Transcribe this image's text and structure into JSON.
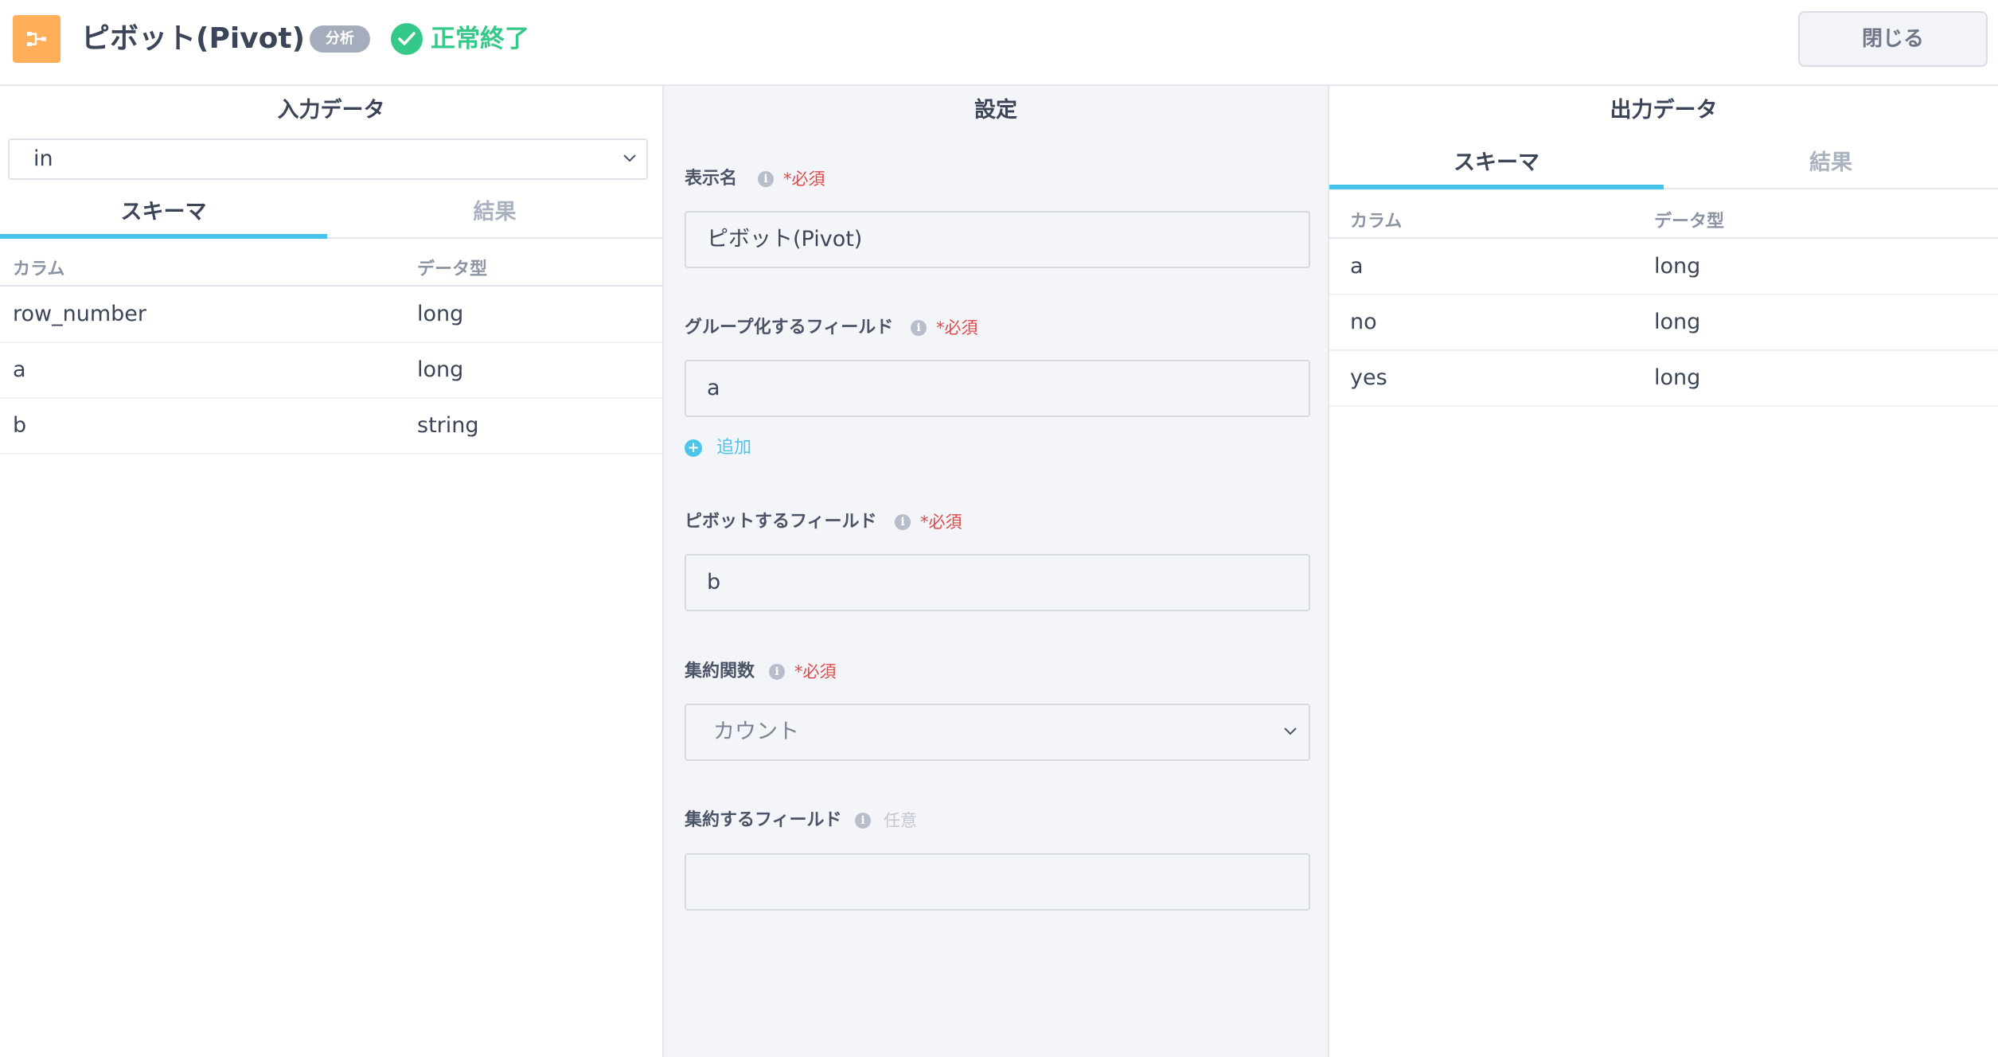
{
  "header": {
    "title": "ピボット(Pivot)",
    "category_badge": "分析",
    "status_text": "正常終了",
    "close_label": "閉じる",
    "node_icon": "pivot-node-icon",
    "accent_color": "#ffae5a",
    "status_color": "#35c989"
  },
  "input_panel": {
    "title": "入力データ",
    "selected_input": "in",
    "tabs": [
      {
        "label": "スキーマ",
        "active": true
      },
      {
        "label": "結果",
        "active": false
      }
    ],
    "columns_header": {
      "column": "カラム",
      "type": "データ型"
    },
    "rows": [
      {
        "column": "row_number",
        "type": "long"
      },
      {
        "column": "a",
        "type": "long"
      },
      {
        "column": "b",
        "type": "string"
      }
    ]
  },
  "settings_panel": {
    "title": "設定",
    "required_text": "*必須",
    "optional_text": "任意",
    "display_name": {
      "label": "表示名",
      "value": "ピボット(Pivot)"
    },
    "group_fields": {
      "label": "グループ化するフィールド",
      "value": "a",
      "add_label": "追加"
    },
    "pivot_field": {
      "label": "ピボットするフィールド",
      "value": "b"
    },
    "aggregate_function": {
      "label": "集約関数",
      "value": "カウント"
    },
    "aggregate_field": {
      "label": "集約するフィールド",
      "value": ""
    }
  },
  "output_panel": {
    "title": "出力データ",
    "tabs": [
      {
        "label": "スキーマ",
        "active": true
      },
      {
        "label": "結果",
        "active": false
      }
    ],
    "columns_header": {
      "column": "カラム",
      "type": "データ型"
    },
    "rows": [
      {
        "column": "a",
        "type": "long"
      },
      {
        "column": "no",
        "type": "long"
      },
      {
        "column": "yes",
        "type": "long"
      }
    ]
  },
  "tab_accent_color": "#45c3ea"
}
